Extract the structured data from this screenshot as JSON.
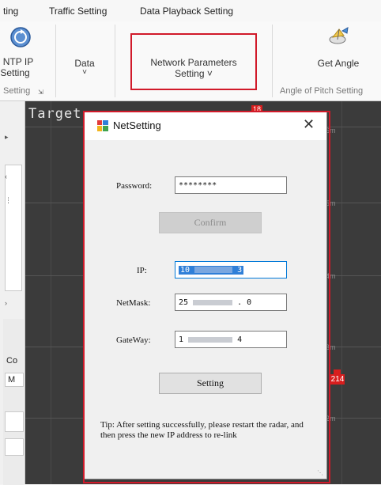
{
  "tabs": [
    "ting",
    "Traffic Setting",
    "Data Playback Setting"
  ],
  "ribbon": {
    "ntp_line1": "NTP IP",
    "ntp_line2": "Setting",
    "data_label": "Data",
    "data_arrow": "˅",
    "network_line1": "Network Parameters",
    "network_line2": "Setting ˅",
    "get_angle": "Get Angle",
    "group_setting": "Setting",
    "group_angle": "Angle of Pitch Setting"
  },
  "left_panel": {
    "co": "Co",
    "m": "M"
  },
  "radar": {
    "title": "Target",
    "marker_top": "18",
    "marker_target": "214",
    "ranges": [
      "6m",
      "5m",
      "4m",
      "3m",
      "2m"
    ]
  },
  "dialog": {
    "title": "NetSetting",
    "close": "✕",
    "password_label": "Password:",
    "password_value": "********",
    "confirm_label": "Confirm",
    "ip_label": "IP:",
    "ip_value_prefix": "10",
    "ip_value_suffix": "3",
    "netmask_label": "NetMask:",
    "netmask_prefix": "25",
    "netmask_suffix": ". 0",
    "gateway_label": "GateWay:",
    "gateway_prefix": "1",
    "gateway_suffix": "4",
    "setting_label": "Setting",
    "tip": "Tip: After setting successfully, please restart the radar, and then press the new IP address to re-link"
  },
  "colors": {
    "highlight": "#d11a2a",
    "marker": "#d81e1e",
    "selection": "#2f7fd8",
    "radar_bg": "#3b3b3b"
  }
}
